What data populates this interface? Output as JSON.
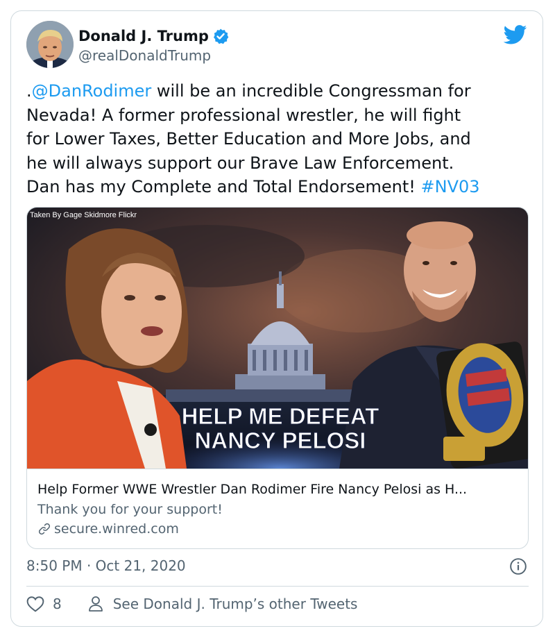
{
  "author": {
    "display_name": "Donald J. Trump",
    "handle": "@realDonaldTrump",
    "verified": true
  },
  "tweet": {
    "text_prefix": ".",
    "mention": "@DanRodimer",
    "line1_rest": " will be an incredible Congressman for",
    "line2": "Nevada! A former professional wrestler, he will fight",
    "line3": "for Lower Taxes, Better Education and More Jobs, and",
    "line4": "he will always support our Brave Law Enforcement.",
    "line5_text": "Dan has my Complete and Total Endorsement! ",
    "hashtag": "#NV03"
  },
  "card": {
    "image_credit": "Taken By Gage Skidmore Flickr",
    "image_headline_line1": "HELP ME DEFEAT",
    "image_headline_line2": "NANCY PELOSI",
    "title": "Help Former WWE Wrestler Dan Rodimer Fire Nancy Pelosi as H...",
    "description": "Thank you for your support!",
    "domain": "secure.winred.com"
  },
  "timestamp": "8:50 PM · Oct 21, 2020",
  "actions": {
    "like_count": "8",
    "other_tweets_label": "See Donald J. Trump’s other Tweets"
  },
  "colors": {
    "link": "#1d9bf0",
    "secondary": "#536471",
    "border": "#cfd9de"
  },
  "icons": [
    "verified-badge-icon",
    "twitter-bird-icon",
    "link-icon",
    "info-icon",
    "heart-icon",
    "person-icon"
  ]
}
